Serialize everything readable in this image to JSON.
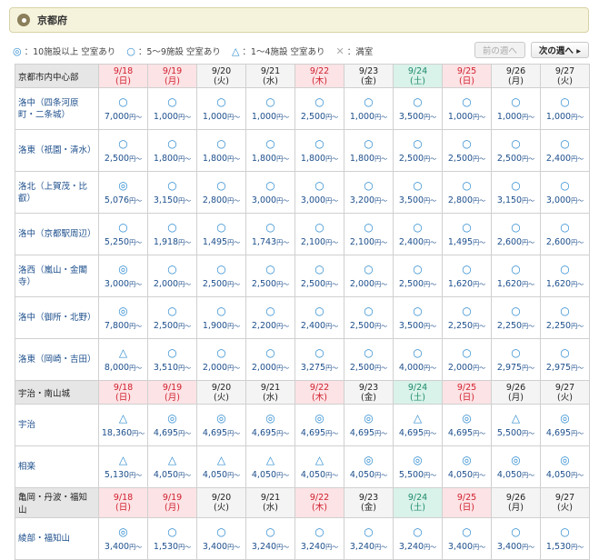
{
  "header": {
    "title": "京都府"
  },
  "legend": [
    {
      "symbol": "◎",
      "text": "：10施設以上 空室あり"
    },
    {
      "symbol": "○",
      "text": "：5〜9施設 空室あり"
    },
    {
      "symbol": "△",
      "text": "：1〜4施設 空室あり"
    },
    {
      "symbol": "✕",
      "text": "：満室"
    }
  ],
  "nav": {
    "prev_label": "前の週へ",
    "next_label": "次の週へ ▸"
  },
  "price_unit": "円〜",
  "dates": [
    {
      "date": "9/18",
      "day": "(日)",
      "kind": "sun"
    },
    {
      "date": "9/19",
      "day": "(月)",
      "kind": "hol"
    },
    {
      "date": "9/20",
      "day": "(火)",
      "kind": ""
    },
    {
      "date": "9/21",
      "day": "(水)",
      "kind": ""
    },
    {
      "date": "9/22",
      "day": "(木)",
      "kind": "hol"
    },
    {
      "date": "9/23",
      "day": "(金)",
      "kind": ""
    },
    {
      "date": "9/24",
      "day": "(土)",
      "kind": "sat"
    },
    {
      "date": "9/25",
      "day": "(日)",
      "kind": "sun"
    },
    {
      "date": "9/26",
      "day": "(月)",
      "kind": ""
    },
    {
      "date": "9/27",
      "day": "(火)",
      "kind": ""
    }
  ],
  "sections": [
    {
      "name": "京都市内中心部",
      "rows": [
        {
          "name": "洛中（四条河原町・二条城）",
          "cells": [
            [
              "○",
              "7,000"
            ],
            [
              "○",
              "1,000"
            ],
            [
              "○",
              "1,000"
            ],
            [
              "○",
              "1,000"
            ],
            [
              "○",
              "2,500"
            ],
            [
              "○",
              "1,000"
            ],
            [
              "○",
              "3,500"
            ],
            [
              "○",
              "1,000"
            ],
            [
              "○",
              "1,000"
            ],
            [
              "○",
              "1,000"
            ]
          ]
        },
        {
          "name": "洛東（祇園・清水）",
          "cells": [
            [
              "○",
              "2,500"
            ],
            [
              "○",
              "1,800"
            ],
            [
              "○",
              "1,800"
            ],
            [
              "○",
              "1,800"
            ],
            [
              "○",
              "1,800"
            ],
            [
              "○",
              "1,800"
            ],
            [
              "○",
              "2,500"
            ],
            [
              "○",
              "2,500"
            ],
            [
              "○",
              "2,500"
            ],
            [
              "○",
              "2,400"
            ]
          ]
        },
        {
          "name": "洛北（上賀茂・比叡）",
          "cells": [
            [
              "◎",
              "5,076"
            ],
            [
              "○",
              "3,150"
            ],
            [
              "○",
              "2,800"
            ],
            [
              "○",
              "3,000"
            ],
            [
              "○",
              "3,000"
            ],
            [
              "○",
              "3,200"
            ],
            [
              "○",
              "3,500"
            ],
            [
              "○",
              "2,800"
            ],
            [
              "○",
              "3,150"
            ],
            [
              "○",
              "3,000"
            ]
          ]
        },
        {
          "name": "洛中（京都駅周辺）",
          "cells": [
            [
              "○",
              "5,250"
            ],
            [
              "○",
              "1,918"
            ],
            [
              "○",
              "1,495"
            ],
            [
              "○",
              "1,743"
            ],
            [
              "○",
              "2,100"
            ],
            [
              "○",
              "2,100"
            ],
            [
              "○",
              "2,400"
            ],
            [
              "○",
              "1,495"
            ],
            [
              "○",
              "2,600"
            ],
            [
              "○",
              "2,600"
            ]
          ]
        },
        {
          "name": "洛西（嵐山・金閣寺）",
          "cells": [
            [
              "◎",
              "3,000"
            ],
            [
              "○",
              "2,000"
            ],
            [
              "○",
              "2,500"
            ],
            [
              "○",
              "2,500"
            ],
            [
              "○",
              "2,500"
            ],
            [
              "○",
              "2,000"
            ],
            [
              "○",
              "2,500"
            ],
            [
              "○",
              "1,620"
            ],
            [
              "○",
              "1,620"
            ],
            [
              "○",
              "1,620"
            ]
          ]
        },
        {
          "name": "洛中（御所・北野）",
          "cells": [
            [
              "◎",
              "7,800"
            ],
            [
              "○",
              "2,500"
            ],
            [
              "○",
              "1,900"
            ],
            [
              "○",
              "2,200"
            ],
            [
              "○",
              "2,400"
            ],
            [
              "○",
              "2,500"
            ],
            [
              "○",
              "3,500"
            ],
            [
              "○",
              "2,250"
            ],
            [
              "○",
              "2,250"
            ],
            [
              "○",
              "2,250"
            ]
          ]
        },
        {
          "name": "洛東（岡崎・吉田）",
          "cells": [
            [
              "△",
              "8,000"
            ],
            [
              "○",
              "3,510"
            ],
            [
              "○",
              "2,000"
            ],
            [
              "○",
              "2,000"
            ],
            [
              "○",
              "3,275"
            ],
            [
              "○",
              "2,500"
            ],
            [
              "○",
              "4,000"
            ],
            [
              "○",
              "2,000"
            ],
            [
              "○",
              "2,975"
            ],
            [
              "○",
              "2,975"
            ]
          ]
        }
      ]
    },
    {
      "name": "宇治・南山城",
      "rows": [
        {
          "name": "宇治",
          "cells": [
            [
              "△",
              "18,360"
            ],
            [
              "◎",
              "4,695"
            ],
            [
              "◎",
              "4,695"
            ],
            [
              "◎",
              "4,695"
            ],
            [
              "◎",
              "4,695"
            ],
            [
              "◎",
              "4,695"
            ],
            [
              "△",
              "4,695"
            ],
            [
              "◎",
              "4,695"
            ],
            [
              "△",
              "5,500"
            ],
            [
              "◎",
              "4,695"
            ]
          ]
        },
        {
          "name": "相楽",
          "cells": [
            [
              "△",
              "5,130"
            ],
            [
              "△",
              "4,050"
            ],
            [
              "△",
              "4,050"
            ],
            [
              "△",
              "4,050"
            ],
            [
              "△",
              "4,050"
            ],
            [
              "◎",
              "4,050"
            ],
            [
              "◎",
              "5,500"
            ],
            [
              "◎",
              "4,050"
            ],
            [
              "◎",
              "4,050"
            ],
            [
              "◎",
              "4,050"
            ]
          ]
        }
      ]
    },
    {
      "name": "亀岡・丹波・福知山",
      "rows": [
        {
          "name": "綾部・福知山",
          "cells": [
            [
              "◎",
              "3,400"
            ],
            [
              "○",
              "1,530"
            ],
            [
              "○",
              "3,400"
            ],
            [
              "○",
              "3,240"
            ],
            [
              "○",
              "3,240"
            ],
            [
              "○",
              "3,240"
            ],
            [
              "○",
              "3,240"
            ],
            [
              "○",
              "3,400"
            ],
            [
              "○",
              "3,400"
            ],
            [
              "○",
              "1,530"
            ]
          ]
        }
      ]
    }
  ]
}
